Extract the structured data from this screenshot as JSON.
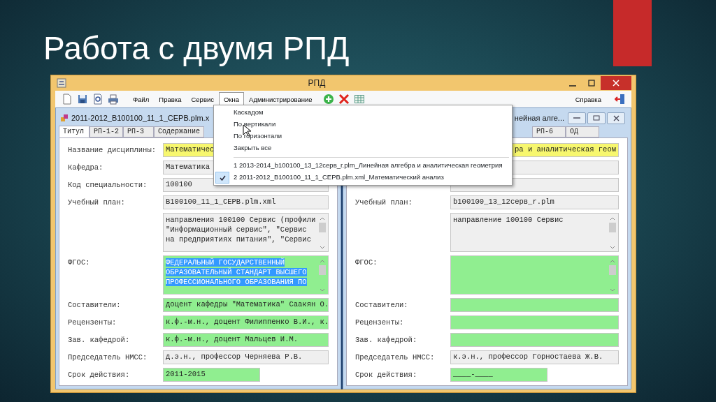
{
  "slide": {
    "title": "Работа с двумя РПД"
  },
  "window": {
    "title": "РПД"
  },
  "menu_bar": {
    "items": [
      {
        "label": "Файл",
        "selected": false
      },
      {
        "label": "Правка",
        "selected": false
      },
      {
        "label": "Сервис",
        "selected": false
      },
      {
        "label": "Окна",
        "selected": true
      },
      {
        "label": "Администрирование",
        "selected": false
      }
    ],
    "help": "Справка"
  },
  "windows_menu": {
    "commands": [
      "Каскадом",
      "По вертикали",
      "По горизонтали",
      "Закрыть все"
    ],
    "windows": [
      {
        "label": "1 2013-2014_b100100_13_12серв_r.plm_Линейная алгебра и аналитическая геометрия",
        "checked": false
      },
      {
        "label": "2 2011-2012_B100100_11_1_СЕРВ.plm.xml_Математический анализ",
        "checked": true
      }
    ]
  },
  "documents": [
    {
      "title": "2011-2012_B100100_11_1_СЕРВ.plm.x",
      "tabs": [
        {
          "label": "Титул",
          "selected": true
        },
        {
          "label": "РП-1-2",
          "selected": false
        },
        {
          "label": "РП-3",
          "selected": false
        },
        {
          "label": "Содержание",
          "selected": false
        }
      ],
      "fields": [
        {
          "kind": "line",
          "label": "Название дисциплины:",
          "value": "Математичес",
          "color": "#f7f76e"
        },
        {
          "kind": "line",
          "label": "Кафедра:",
          "value": "Математика",
          "color": "#efefef"
        },
        {
          "kind": "line",
          "label": "Код специальности:",
          "value": "100100",
          "color": "#efefef"
        },
        {
          "kind": "line",
          "label": "Учебный план:",
          "value": "B100100_11_1_СЕРВ.plm.xml",
          "color": "#efefef"
        },
        {
          "kind": "multiline",
          "value": "направления 100100 Сервис (профили\n\"Информационный сервис\", \"Сервис\nна предприятиях питания\", \"Сервис",
          "color": "#efefef",
          "selected": false
        },
        {
          "kind": "multiline",
          "label": "ФГОС:",
          "value": "ФЕДЕРАЛЬНЫЙ ГОСУДАРСТВЕННЫЙ\nОБРАЗОВАТЕЛЬНЫЙ СТАНДАРТ ВЫСШЕГО\nПРОФЕССИОНАЛЬНОГО ОБРАЗОВАНИЯ ПО",
          "color": "#90ee90",
          "selected": true
        },
        {
          "kind": "line",
          "label": "Составители:",
          "value": "доцент кафедры \"Математика\" Саакян О.",
          "color": "#90ee90"
        },
        {
          "kind": "line",
          "label": "Рецензенты:",
          "value": "к.ф.-м.н., доцент Филиппенко В.И., к.",
          "color": "#90ee90"
        },
        {
          "kind": "line",
          "label": "Зав. кафедрой:",
          "value": "к.ф.-м.н., доцент Мальцев И.М.",
          "color": "#90ee90"
        },
        {
          "kind": "line",
          "label": "Председатель НМСС:",
          "value": "д.э.н., профессор Черняева Р.В.",
          "color": "#efefef"
        },
        {
          "kind": "short",
          "label": "Срок действия:",
          "value": "2011-2015",
          "color": "#90ee90"
        }
      ]
    },
    {
      "title": "нейная алге...",
      "tabs": [
        {
          "label": "РП-6",
          "selected": false
        },
        {
          "label": "ОД",
          "selected": false
        }
      ],
      "fields": [
        {
          "kind": "line",
          "value": "ра и аналитическая геом",
          "color": "#f7f76e"
        },
        {
          "kind": "line",
          "color": "#efefef"
        },
        {
          "kind": "line",
          "color": "#efefef"
        },
        {
          "kind": "line",
          "label": "Учебный план:",
          "value": "b100100_13_12серв_r.plm",
          "color": "#efefef"
        },
        {
          "kind": "multiline",
          "value": "направление 100100 Сервис",
          "color": "#efefef",
          "selected": false
        },
        {
          "kind": "multiline",
          "label": "ФГОС:",
          "color": "#90ee90"
        },
        {
          "kind": "line",
          "label": "Составители:",
          "color": "#90ee90"
        },
        {
          "kind": "line",
          "label": "Рецензенты:",
          "color": "#90ee90"
        },
        {
          "kind": "line",
          "label": "Зав. кафедрой:",
          "color": "#90ee90"
        },
        {
          "kind": "line",
          "label": "Председатель НМСС:",
          "value": "к.э.н., профессор Горностаева Ж.В.",
          "color": "#efefef"
        },
        {
          "kind": "short",
          "label": "Срок действия:",
          "value": "____-____",
          "color": "#90ee90"
        }
      ]
    }
  ]
}
